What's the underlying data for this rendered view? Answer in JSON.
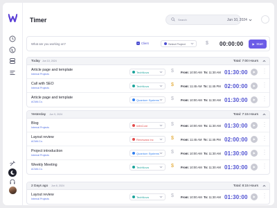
{
  "app": {
    "title": "Timer",
    "accent": "#6c5ce7",
    "brand": "#4d4fd1"
  },
  "header": {
    "search_placeholder": "Search",
    "date": "Jun 10, 2024"
  },
  "sidebar": {
    "icons": [
      "clock-icon",
      "globe-icon",
      "stack-icon",
      "tasks-icon",
      "notes-icon",
      "moon-icon",
      "headphones-icon"
    ]
  },
  "entry": {
    "placeholder": "What are you working on?",
    "client_label": "Client",
    "project_label": "Select Project",
    "timer": "00:00:00",
    "start_label": "Start"
  },
  "labels": {
    "from": "From:",
    "to": "To:"
  },
  "groups": [
    {
      "day": "Today",
      "date": "Jun 10, 2024",
      "total": "Total: 7:00 Hours",
      "entries": [
        {
          "title": "Article page and template",
          "sub": "Internal Projects",
          "project": "TechNova",
          "project_color": "#1aa39b",
          "billable": false,
          "from": "10:00 AM",
          "to": "11:30 AM",
          "duration": "01:30:00"
        },
        {
          "title": "Call with SEO",
          "sub": "Internal Projects",
          "project": "TechNova",
          "project_color": "#1aa39b",
          "billable": true,
          "from": "11:45 AM",
          "to": "11:45 PM",
          "duration": "02:00:00"
        },
        {
          "title": "Article page and template",
          "sub": "ACMA Co.",
          "project": "Quantum Systems",
          "project_color": "#2f7ef0",
          "billable": false,
          "from": "10:00 AM",
          "to": "11:30 AM",
          "duration": "01:30:00"
        }
      ]
    },
    {
      "day": "Yesterday",
      "date": "Jun 9, 2024",
      "total": "Total: 7:15 Hours",
      "entries": [
        {
          "title": "Blog",
          "sub": "Internal Projects",
          "project": "InfinCore",
          "project_color": "#e34b4b",
          "billable": false,
          "from": "10:00 AM",
          "to": "11:30 AM",
          "duration": "01:30:00"
        },
        {
          "title": "Layout review",
          "sub": "ACMA Co.",
          "project": "Renewara Inc",
          "project_color": "#e34b4b",
          "billable": true,
          "from": "11:45 AM",
          "to": "11:45 PM",
          "duration": "02:00:00"
        },
        {
          "title": "Project introduction",
          "sub": "Internal Projects",
          "project": "Quantum Systems",
          "project_color": "#2f7ef0",
          "billable": false,
          "from": "10:00 AM",
          "to": "11:30 AM",
          "duration": "01:30:00"
        },
        {
          "title": "Weekly Meeting",
          "sub": "ACMA Co.",
          "project": "TechNova",
          "project_color": "#1aa39b",
          "billable": true,
          "from": "10:00 AM",
          "to": "11:30 AM",
          "duration": "01:30:00"
        }
      ]
    },
    {
      "day": "2 Days ago",
      "date": "Jun 8, 2024",
      "total": "Total: 8:15 Hours",
      "entries": [
        {
          "title": "Layout review",
          "sub": "Internal Projects",
          "project": "TechNova",
          "project_color": "#1aa39b",
          "billable": false,
          "from": "10:00 AM",
          "to": "11:30 AM",
          "duration": "01:30:00"
        }
      ]
    }
  ]
}
